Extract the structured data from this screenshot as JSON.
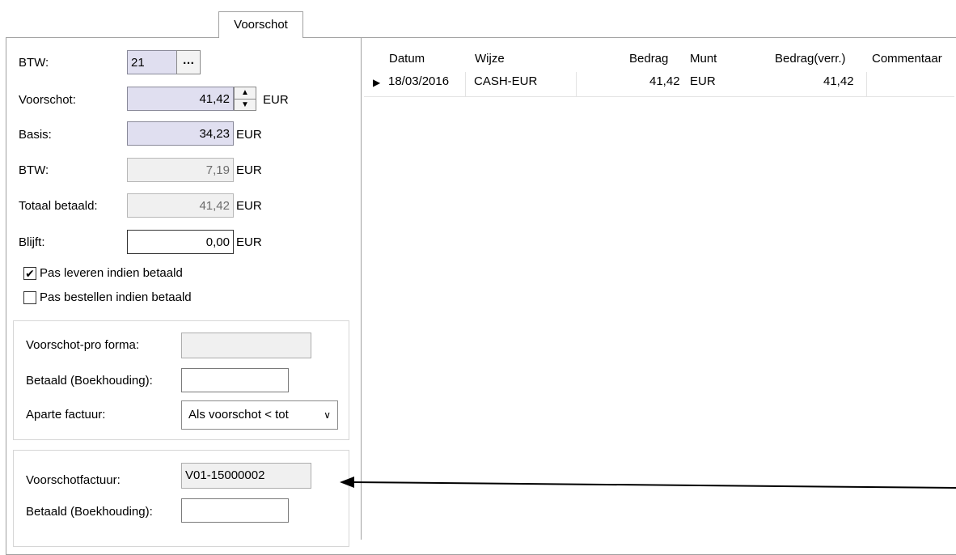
{
  "tab": {
    "label": "Voorschot"
  },
  "form": {
    "btw_rate_label": "BTW:",
    "btw_rate_value": "21",
    "ellipsis": "…",
    "voorschot_label": "Voorschot:",
    "voorschot_value": "41,42",
    "voorschot_unit": "EUR",
    "basis_label": "Basis:",
    "basis_value": "34,23",
    "basis_unit": "EUR",
    "btw_amount_label": "BTW:",
    "btw_amount_value": "7,19",
    "btw_amount_unit": "EUR",
    "totaal_label": "Totaal betaald:",
    "totaal_value": "41,42",
    "totaal_unit": "EUR",
    "blijft_label": "Blijft:",
    "blijft_value": "0,00",
    "blijft_unit": "EUR",
    "check_leveren_label": "Pas leveren indien betaald",
    "check_leveren_checked": true,
    "check_bestellen_label": "Pas bestellen indien betaald",
    "check_bestellen_checked": false
  },
  "proforma": {
    "voorschot_proforma_label": "Voorschot-pro forma:",
    "voorschot_proforma_value": "",
    "betaald_label": "Betaald (Boekhouding):",
    "betaald_value": "",
    "aparte_label": "Aparte factuur:",
    "aparte_value": "Als voorschot < tot"
  },
  "invoice": {
    "voorschotfactuur_label": "Voorschotfactuur:",
    "voorschotfactuur_value": "V01-15000002",
    "betaald_label": "Betaald (Boekhouding):",
    "betaald_value": ""
  },
  "grid": {
    "headers": [
      "Datum",
      "Wijze",
      "Bedrag",
      "Munt",
      "Bedrag(verr.)",
      "Commentaar"
    ],
    "rows": [
      {
        "datum": "18/03/2016",
        "wijze": "CASH-EUR",
        "bedrag": "41,42",
        "munt": "EUR",
        "bedrag_verr": "41,42",
        "commentaar": ""
      }
    ]
  }
}
